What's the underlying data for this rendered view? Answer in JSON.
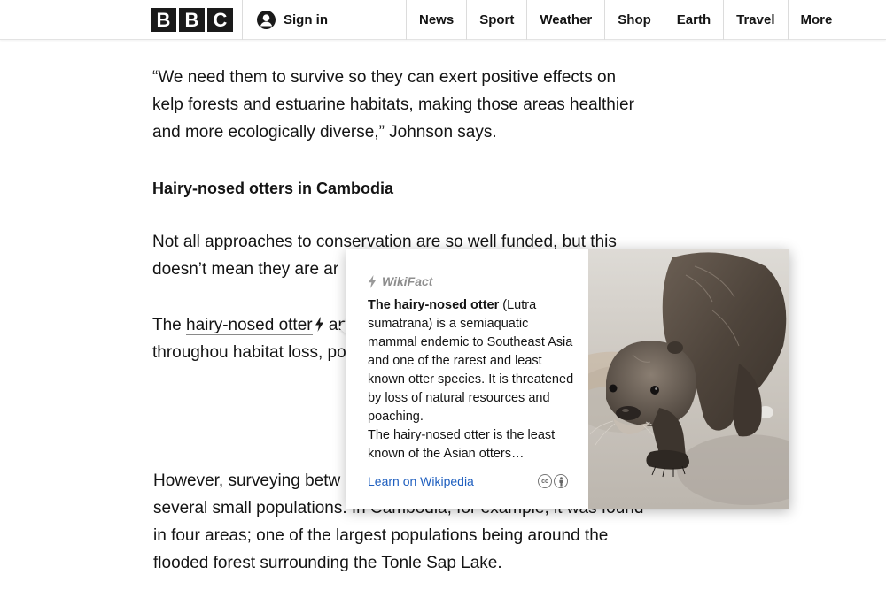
{
  "header": {
    "logo_letters": [
      "B",
      "B",
      "C"
    ],
    "signin_label": "Sign in",
    "nav": [
      "News",
      "Sport",
      "Weather",
      "Shop",
      "Earth",
      "Travel",
      "More"
    ]
  },
  "article": {
    "para1": "“We need them to survive so they can exert positive effects on kelp forests and estuarine habitats, making those areas healthier and more ecologically diverse,” Johnson says.",
    "heading": "Hairy-nosed otters in Cambodia",
    "para2": "Not all approaches to conservation are so well funded, but this doesn’t mean they are ar",
    "para3_prefix": "The ",
    "para3_link": "hairy-nosed otter",
    "para3_rest": " and most endangered sp thought extinct throughou habitat loss, poaching, lo loss of its sources of food",
    "para4": "However, surveying betw habitats confirmed the presence of several small populations. In Cambodia, for example, it was found in four areas; one of the largest populations being around the flooded forest surrounding the Tonle Sap Lake."
  },
  "wikifact": {
    "title": "WikiFact",
    "body_bold": "The hairy-nosed otter",
    "body_rest": " (Lutra sumatrana) is a semiaquatic mammal endemic to Southeast Asia and one of the rarest and least known otter species. It is threatened by loss of natural resources and poaching.",
    "body_second": "The hairy-nosed otter is the least known of the Asian otters…",
    "link_label": "Learn on Wikipedia",
    "license_icons": [
      "cc-icon",
      "attribution-icon"
    ],
    "cc_text": "cc",
    "accent_color": "#1f5fbf"
  }
}
